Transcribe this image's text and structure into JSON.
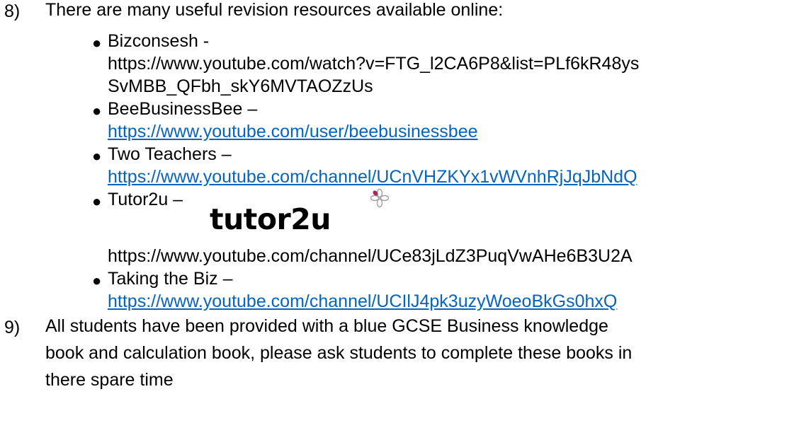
{
  "items": [
    {
      "number": "8)",
      "text": "There are many useful revision resources available online:"
    },
    {
      "number": "9)",
      "text_lines": [
        "All students have been provided with a blue GCSE Business knowledge",
        "book and calculation book, please ask students to complete these books in",
        "there spare time"
      ]
    }
  ],
  "resources": [
    {
      "name": "Bizconsesh -",
      "url_lines": [
        "https://www.youtube.com/watch?v=FTG_l2CA6P8&list=PLf6kR48ys",
        "SvMBB_QFbh_skY6MVTAOZzUs"
      ],
      "linked": false
    },
    {
      "name": "BeeBusinessBee –",
      "url": "https://www.youtube.com/user/beebusinessbee",
      "linked": true
    },
    {
      "name": "Two Teachers –",
      "url": "https://www.youtube.com/channel/UCnVHZKYx1vWVnhRjJqJbNdQ",
      "linked": true
    },
    {
      "name": "Tutor2u –",
      "url": "https://www.youtube.com/channel/UCe83jLdZ3PuqVwAHe6B3U2A",
      "linked": false,
      "logo": "tutor2u"
    },
    {
      "name": "Taking the Biz –",
      "url": "https://www.youtube.com/channel/UCIlJ4pk3uzyWoeoBkGs0hxQ",
      "linked": true
    }
  ],
  "colors": {
    "link": "#0563c1",
    "text": "#000000"
  }
}
